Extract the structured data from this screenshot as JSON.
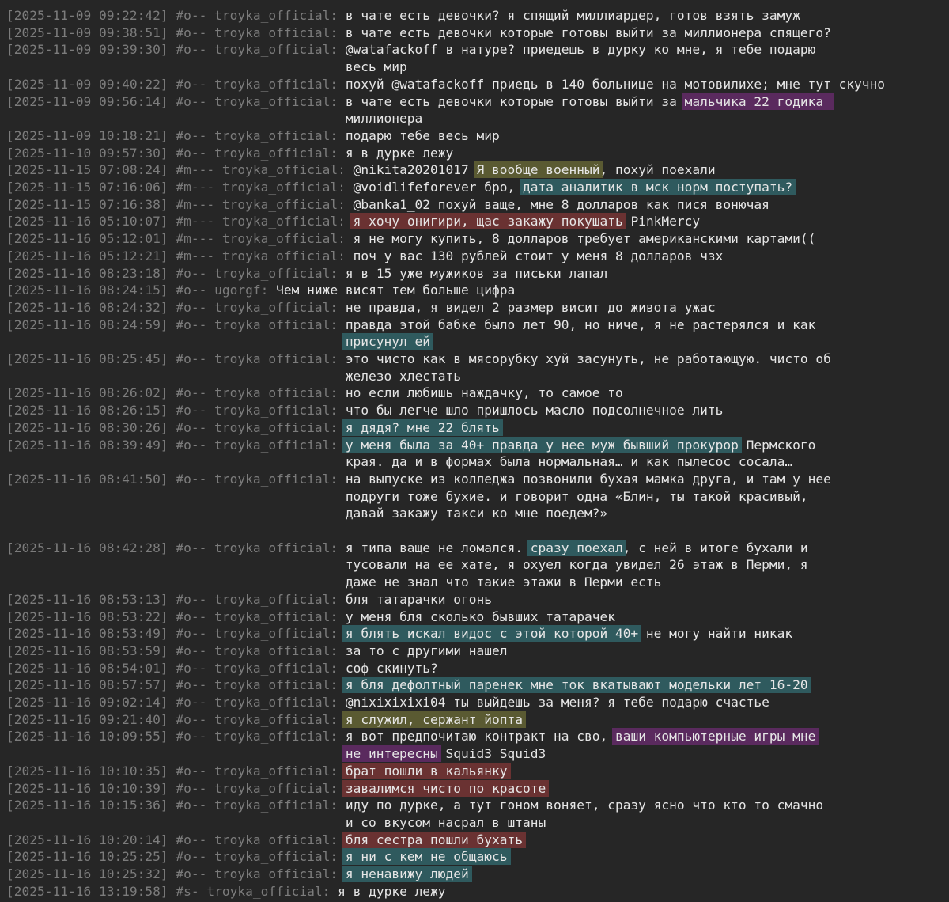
{
  "log": {
    "lines": [
      {
        "ts": "[2025-11-09 09:22:42]",
        "ch": "#o--",
        "nick": "troyka_official",
        "segs": [
          {
            "t": "в чате есть девочки? я спящий миллиардер, готов взять замуж"
          }
        ]
      },
      {
        "ts": "[2025-11-09 09:38:51]",
        "ch": "#o--",
        "nick": "troyka_official",
        "segs": [
          {
            "t": "в чате есть девочки которые готовы выйти за миллионера спящего?"
          }
        ]
      },
      {
        "ts": "[2025-11-09 09:39:30]",
        "ch": "#o--",
        "nick": "troyka_official",
        "segs": [
          {
            "t": "@watafackoff в натуре? приедешь в дурку ко мне, я тебе подарю"
          }
        ]
      },
      {
        "segs": [
          {
            "t": "весь мир"
          }
        ]
      },
      {
        "ts": "[2025-11-09 09:40:22]",
        "ch": "#o--",
        "nick": "troyka_official",
        "segs": [
          {
            "t": "похуй @watafackoff приедь в 140 больнице на мотовилихе; мне тут скучно"
          }
        ]
      },
      {
        "ts": "[2025-11-09 09:56:14]",
        "ch": "#o--",
        "nick": "troyka_official",
        "segs": [
          {
            "t": "в чате есть девочки которые готовы выйти за "
          },
          {
            "t": "мальчика 22 годика ",
            "hl": "purple"
          }
        ]
      },
      {
        "segs": [
          {
            "t": "миллионера"
          }
        ]
      },
      {
        "ts": "[2025-11-09 10:18:21]",
        "ch": "#o--",
        "nick": "troyka_official",
        "segs": [
          {
            "t": "подарю тебе весь мир"
          }
        ]
      },
      {
        "ts": "[2025-11-10 09:57:30]",
        "ch": "#o--",
        "nick": "troyka_official",
        "segs": [
          {
            "t": "я в дурке лежу"
          }
        ]
      },
      {
        "ts": "[2025-11-15 07:08:24]",
        "ch": "#m---",
        "nick": "troyka_official",
        "segs": [
          {
            "t": "@nikita20201017 "
          },
          {
            "t": "Я вообще военный",
            "hl": "olive"
          },
          {
            "t": ", похуй поехали"
          }
        ]
      },
      {
        "ts": "[2025-11-15 07:16:06]",
        "ch": "#m---",
        "nick": "troyka_official",
        "segs": [
          {
            "t": "@voidlifeforever бро, "
          },
          {
            "t": "дата аналитик в мск норм поступать?",
            "hl": "teal"
          }
        ]
      },
      {
        "ts": "[2025-11-15 07:16:38]",
        "ch": "#m---",
        "nick": "troyka_official",
        "segs": [
          {
            "t": "@banka1_02 похуй ваще, мне 8 долларов как пися вонючая"
          }
        ]
      },
      {
        "ts": "[2025-11-16 05:10:07]",
        "ch": "#m---",
        "nick": "troyka_official",
        "segs": [
          {
            "t": "я хочу онигири, щас закажу покушать",
            "hl": "red"
          },
          {
            "t": " PinkMercy"
          }
        ]
      },
      {
        "ts": "[2025-11-16 05:12:01]",
        "ch": "#m---",
        "nick": "troyka_official",
        "segs": [
          {
            "t": "я не могу купить, 8 долларов требует американскими картами(("
          }
        ]
      },
      {
        "ts": "[2025-11-16 05:12:21]",
        "ch": "#m---",
        "nick": "troyka_official",
        "segs": [
          {
            "t": "поч у вас 130 рублей стоит у меня 8 долларов чзх"
          }
        ]
      },
      {
        "ts": "[2025-11-16 08:23:18]",
        "ch": "#o--",
        "nick": "troyka_official",
        "segs": [
          {
            "t": "я в 15 уже мужиков за письки лапал"
          }
        ]
      },
      {
        "ts": "[2025-11-16 08:24:15]",
        "ch": "#o--",
        "nick": "ugorgf",
        "segs": [
          {
            "t": "Чем ниже висят тем больше цифра"
          }
        ]
      },
      {
        "ts": "[2025-11-16 08:24:32]",
        "ch": "#o--",
        "nick": "troyka_official",
        "segs": [
          {
            "t": "не правда, я видел 2 размер висит до живота ужас"
          }
        ]
      },
      {
        "ts": "[2025-11-16 08:24:59]",
        "ch": "#o--",
        "nick": "troyka_official",
        "segs": [
          {
            "t": "правда этой бабке было лет 90, но ниче, я не растерялся и как"
          }
        ]
      },
      {
        "segs": [
          {
            "t": "присунул ей",
            "hl": "teal"
          }
        ]
      },
      {
        "ts": "[2025-11-16 08:25:45]",
        "ch": "#o--",
        "nick": "troyka_official",
        "segs": [
          {
            "t": "это чисто как в мясорубку хуй засунуть, не работающую. чисто об"
          }
        ]
      },
      {
        "segs": [
          {
            "t": "железо хлестать"
          }
        ]
      },
      {
        "ts": "[2025-11-16 08:26:02]",
        "ch": "#o--",
        "nick": "troyka_official",
        "segs": [
          {
            "t": "но если любишь наждачку, то самое то"
          }
        ]
      },
      {
        "ts": "[2025-11-16 08:26:15]",
        "ch": "#o--",
        "nick": "troyka_official",
        "segs": [
          {
            "t": "что бы легче шло пришлось масло подсолнечное лить"
          }
        ]
      },
      {
        "ts": "[2025-11-16 08:30:26]",
        "ch": "#o--",
        "nick": "troyka_official",
        "segs": [
          {
            "t": "я дядя? мне 22 блять",
            "hl": "teal"
          }
        ]
      },
      {
        "ts": "[2025-11-16 08:39:49]",
        "ch": "#o--",
        "nick": "troyka_official",
        "segs": [
          {
            "t": "у меня была за 40+ правда у нее муж бывший прокурор",
            "hl": "teal"
          },
          {
            "t": " Пермского"
          }
        ]
      },
      {
        "segs": [
          {
            "t": "края. да и в формах была нормальная… и как пылесос сосала…"
          }
        ]
      },
      {
        "ts": "[2025-11-16 08:41:50]",
        "ch": "#o--",
        "nick": "troyka_official",
        "segs": [
          {
            "t": "на выпуске из колледжа позвонили бухая мамка друга, и там у нее"
          }
        ]
      },
      {
        "segs": [
          {
            "t": "подруги тоже бухие. и говорит одна «Блин, ты такой красивый,"
          }
        ]
      },
      {
        "segs": [
          {
            "t": "давай закажу такси ко мне поедем?»"
          }
        ]
      },
      {
        "segs": [
          {
            "t": ""
          }
        ]
      },
      {
        "ts": "[2025-11-16 08:42:28]",
        "ch": "#o--",
        "nick": "troyka_official",
        "segs": [
          {
            "t": "я типа ваще не ломался. "
          },
          {
            "t": "сразу поехал",
            "hl": "teal"
          },
          {
            "t": ", с ней в итоге бухали и"
          }
        ]
      },
      {
        "segs": [
          {
            "t": "тусовали на ее хате, я охуел когда увидел 26 этаж в Перми, я"
          }
        ]
      },
      {
        "segs": [
          {
            "t": "даже не знал что такие этажи в Перми есть"
          }
        ]
      },
      {
        "ts": "[2025-11-16 08:53:13]",
        "ch": "#o--",
        "nick": "troyka_official",
        "segs": [
          {
            "t": "бля татарачки огонь"
          }
        ]
      },
      {
        "ts": "[2025-11-16 08:53:22]",
        "ch": "#o--",
        "nick": "troyka_official",
        "segs": [
          {
            "t": "у меня бля сколько бывших татарачек"
          }
        ]
      },
      {
        "ts": "[2025-11-16 08:53:49]",
        "ch": "#o--",
        "nick": "troyka_official",
        "segs": [
          {
            "t": "я блять искал видос с этой которой 40+",
            "hl": "teal"
          },
          {
            "t": " не могу найти никак"
          }
        ]
      },
      {
        "ts": "[2025-11-16 08:53:59]",
        "ch": "#o--",
        "nick": "troyka_official",
        "segs": [
          {
            "t": "за то с другими нашел"
          }
        ]
      },
      {
        "ts": "[2025-11-16 08:54:01]",
        "ch": "#o--",
        "nick": "troyka_official",
        "segs": [
          {
            "t": "соф скинуть?"
          }
        ]
      },
      {
        "ts": "[2025-11-16 08:57:57]",
        "ch": "#o--",
        "nick": "troyka_official",
        "segs": [
          {
            "t": "я бля дефолтный паренек мне ток вкатывают модельки лет 16-20",
            "hl": "teal"
          }
        ]
      },
      {
        "ts": "[2025-11-16 09:02:14]",
        "ch": "#o--",
        "nick": "troyka_official",
        "segs": [
          {
            "t": "@nixixixixi04 ты выйдешь за меня? я тебе подарю счастье"
          }
        ]
      },
      {
        "ts": "[2025-11-16 09:21:40]",
        "ch": "#o--",
        "nick": "troyka_official",
        "segs": [
          {
            "t": "я служил, сержант йопта",
            "hl": "olive"
          }
        ]
      },
      {
        "ts": "[2025-11-16 10:09:55]",
        "ch": "#o--",
        "nick": "troyka_official",
        "segs": [
          {
            "t": "я вот предпочитаю контракт на сво, "
          },
          {
            "t": "ваши компьютерные игры мне",
            "hl": "purple"
          }
        ]
      },
      {
        "segs": [
          {
            "t": "не интересны",
            "hl": "purple"
          },
          {
            "t": " Squid3 Squid3"
          }
        ]
      },
      {
        "ts": "[2025-11-16 10:10:35]",
        "ch": "#o--",
        "nick": "troyka_official",
        "segs": [
          {
            "t": "брат пошли в кальянку",
            "hl": "red"
          }
        ]
      },
      {
        "ts": "[2025-11-16 10:10:39]",
        "ch": "#o--",
        "nick": "troyka_official",
        "segs": [
          {
            "t": "завалимся чисто по красоте",
            "hl": "red"
          }
        ]
      },
      {
        "ts": "[2025-11-16 10:15:36]",
        "ch": "#o--",
        "nick": "troyka_official",
        "segs": [
          {
            "t": "иду по дурке, а тут гоном воняет, сразу ясно что кто то смачно"
          }
        ]
      },
      {
        "segs": [
          {
            "t": "и со вкусом насрал в штаны"
          }
        ]
      },
      {
        "ts": "[2025-11-16 10:20:14]",
        "ch": "#o--",
        "nick": "troyka_official",
        "segs": [
          {
            "t": "бля сестра пошли бухать",
            "hl": "red"
          }
        ]
      },
      {
        "ts": "[2025-11-16 10:25:25]",
        "ch": "#o--",
        "nick": "troyka_official",
        "segs": [
          {
            "t": "я ни с кем не общаюсь",
            "hl": "teal"
          }
        ]
      },
      {
        "ts": "[2025-11-16 10:25:32]",
        "ch": "#o--",
        "nick": "troyka_official",
        "segs": [
          {
            "t": "я ненавижу людей",
            "hl": "teal"
          }
        ]
      },
      {
        "ts": "[2025-11-16 13:19:58]",
        "ch": "#s-",
        "nick": "troyka_official",
        "segs": [
          {
            "t": "я в дурке лежу"
          }
        ]
      }
    ]
  },
  "colors": {
    "background": "#262626",
    "meta_text": "#7c7c7c",
    "message_text": "#e6e6e6",
    "highlight_purple": "#5a2a5e",
    "highlight_olive": "#5a5a32",
    "highlight_teal": "#2f5a5e",
    "highlight_red": "#6a3232"
  }
}
